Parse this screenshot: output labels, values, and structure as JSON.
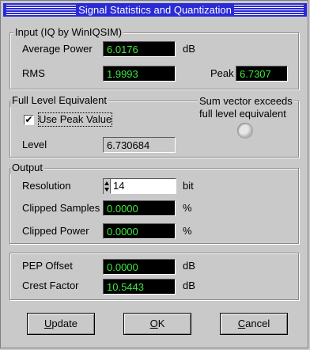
{
  "window": {
    "title": "Signal Statistics and Quantization"
  },
  "input_group": {
    "label": "Input (IQ by WinIQSIM)",
    "average_power_label": "Average Power",
    "average_power_value": "6.0176",
    "average_power_unit": "dB",
    "rms_label": "RMS",
    "rms_value": "1.9993",
    "peak_label": "Peak",
    "peak_value": "6.7307"
  },
  "full_level_group": {
    "label": "Full Level Equivalent",
    "use_peak_label": "Use Peak Value",
    "use_peak_checked": true,
    "checkmark": "✔",
    "level_label": "Level",
    "level_value": "6.730684",
    "warning_text_line1": "Sum vector exceeds",
    "warning_text_line2": "full level equivalent"
  },
  "output_group": {
    "label": "Output",
    "resolution_label": "Resolution",
    "resolution_value": "14",
    "resolution_unit": "bit",
    "clipped_samples_label": "Clipped Samples",
    "clipped_samples_value": "0.0000",
    "clipped_samples_unit": "%",
    "clipped_power_label": "Clipped Power",
    "clipped_power_value": "0.0000",
    "clipped_power_unit": "%"
  },
  "crest_group": {
    "pep_offset_label": "PEP Offset",
    "pep_offset_value": "0.0000",
    "pep_offset_unit": "dB",
    "crest_factor_label": "Crest Factor",
    "crest_factor_value": "10.5443",
    "crest_factor_unit": "dB"
  },
  "buttons": {
    "update_first": "U",
    "update_rest": "pdate",
    "ok_first": "O",
    "ok_rest": "K",
    "cancel_first": "C",
    "cancel_rest": "ancel"
  },
  "colors": {
    "titlebar": "#2a2ad6",
    "window_bg": "#c9c9c9",
    "readout_bg": "#000000",
    "readout_text": "#3ee83e"
  }
}
